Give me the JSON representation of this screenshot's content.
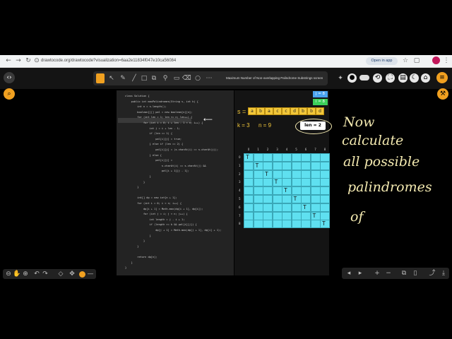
{
  "browser": {
    "url": "drawtocode.org/drawtocode?visualization=6aa2e11834f047e10ca56084",
    "open_in_app": "Open in app"
  },
  "toolbar": {
    "title": "Maximum Number of Non-overlapping Palindrome Substrings screen"
  },
  "code": {
    "lines": [
      "class Solution {",
      "    public int maxPalindromes(String s, int k) {",
      "        int n = s.length();",
      "        boolean[][] pal = new boolean[n][n];",
      "        for (int len = 1; len <= n; len++) {",
      "            for (int i = 0; i + len - 1 < n; i++) {",
      "                int j = i + len - 1;",
      "                if (len == 1) {",
      "                    pal[i][j] = true;",
      "                } else if (len == 2) {",
      "                    pal[i][j] = (s.charAt(i) == s.charAt(j));",
      "                } else {",
      "                    pal[i][j] =",
      "                        s.charAt(i) == s.charAt(j) &&",
      "                        pal[i + 1][j - 1];",
      "                }",
      "            }",
      "        }",
      "",
      "        int[] dp = new int[n + 1];",
      "        for (int i = 0; i < n; i++) {",
      "            dp[i + 1] = Math.max(dp[i + 1], dp[i]);",
      "            for (int j = i; j < n; j++) {",
      "                int length = j - i + 1;",
      "                if (length >= k && pal[i][j]) {",
      "                    dp[j + 1] = Math.max(dp[j + 1], dp[i] + 1);",
      "                }",
      "            }",
      "        }",
      "",
      "        return dp[n];",
      "    }",
      "}"
    ]
  },
  "visual": {
    "s_label": "s =",
    "chars": [
      "a",
      "b",
      "a",
      "c",
      "c",
      "d",
      "b",
      "b",
      "d"
    ],
    "k_label": "k = 3",
    "n_label": "n = 9",
    "i_badge": "i = 8",
    "j_badge": "j = 8",
    "len_badge": "len = 2",
    "col_indices": [
      "0",
      "1",
      "2",
      "3",
      "4",
      "5",
      "6",
      "7",
      "8"
    ],
    "row_indices": [
      "0",
      "1",
      "2",
      "3",
      "4",
      "5",
      "6",
      "7",
      "8"
    ],
    "diag_mark": "T",
    "grid_color": "#5fe0f0",
    "char_color": "#f2c73a"
  },
  "annotation": {
    "lines": [
      "Now",
      "calculate",
      "all possible",
      "palindromes",
      "of"
    ]
  }
}
